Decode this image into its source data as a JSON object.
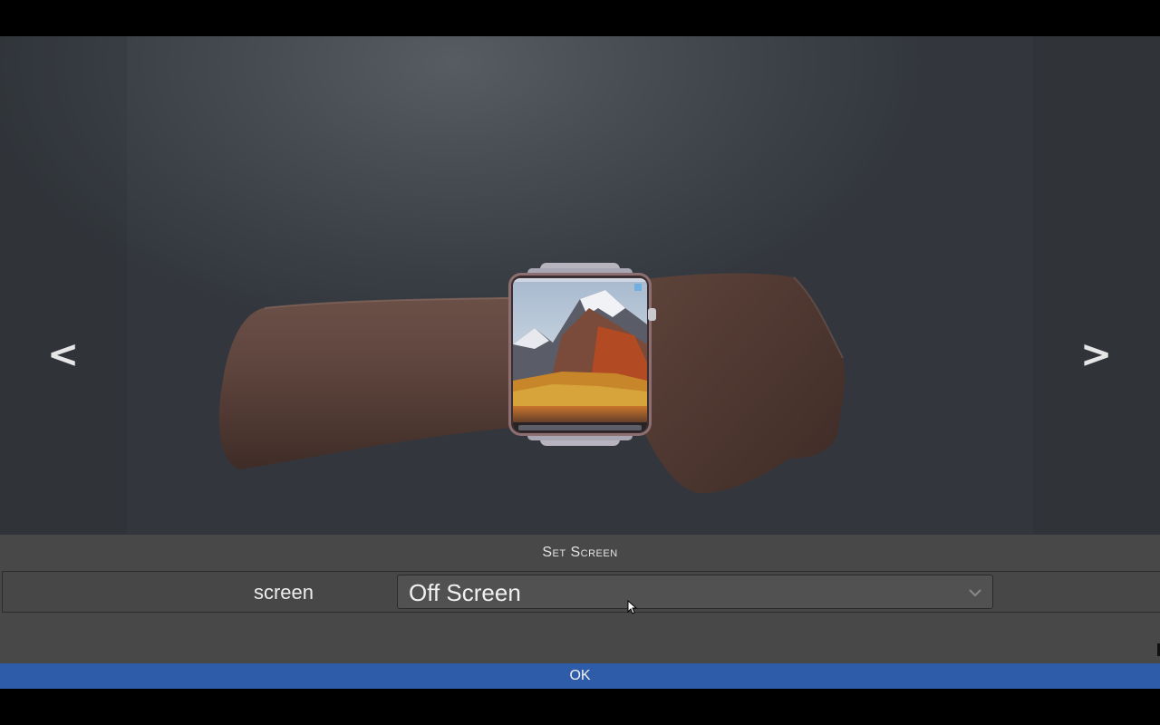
{
  "viewer": {
    "prev_label": "<",
    "next_label": ">"
  },
  "dialog": {
    "title": "Set Screen",
    "field_label": "screen",
    "selected_value": "Off Screen",
    "ok_label": "OK"
  },
  "colors": {
    "ok_bar": "#2f5ca8",
    "panel": "#484848",
    "skin": "#5a4238"
  },
  "icons": {
    "dropdown": "chevron-down-icon",
    "cursor": "mouse-pointer-icon"
  }
}
